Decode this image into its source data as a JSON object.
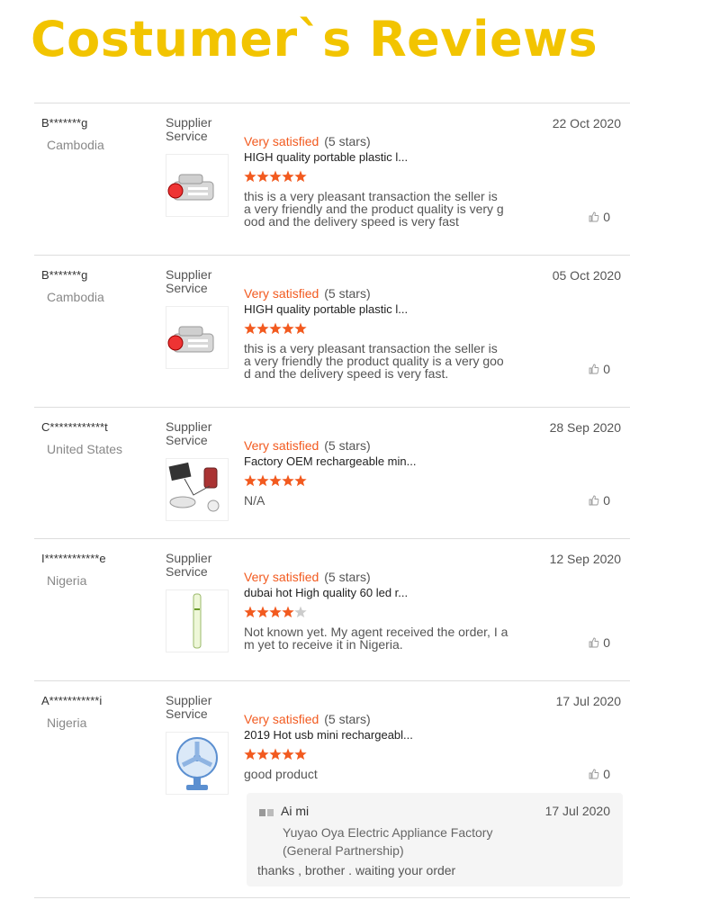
{
  "page": {
    "title": "Costumer`s Reviews"
  },
  "supplier_label": [
    "Supplier",
    "Service"
  ],
  "reviews": [
    {
      "reviewer": "B*******g",
      "country": "Cambodia",
      "date": "22 Oct 2020",
      "rating_text": "Very satisfied",
      "rating_count": "(5 stars)",
      "stars": 5,
      "product_title": "HIGH quality portable plastic l...",
      "text_lines": [
        "this is a very pleasant transaction the seller is",
        "a very friendly and the product quality is very g",
        "ood and the delivery speed is very fast"
      ],
      "likes": "0",
      "thumb_icon": "flashlight-icon"
    },
    {
      "reviewer": "B*******g",
      "country": "Cambodia",
      "date": "05 Oct 2020",
      "rating_text": "Very satisfied",
      "rating_count": "(5 stars)",
      "stars": 5,
      "product_title": "HIGH quality portable plastic l...",
      "text_lines": [
        "this is a very pleasant transaction the seller is",
        "a very friendly the product quality is a very goo",
        "d and the delivery speed is very fast."
      ],
      "likes": "0",
      "thumb_icon": "flashlight-icon"
    },
    {
      "reviewer": "C************t",
      "country": "United States",
      "date": "28 Sep 2020",
      "rating_text": "Very satisfied",
      "rating_count": "(5 stars)",
      "stars": 5,
      "product_title": "Factory OEM rechargeable min...",
      "text_lines": [
        "N/A"
      ],
      "likes": "0",
      "thumb_icon": "solar-kit-icon"
    },
    {
      "reviewer": "I************e",
      "country": "Nigeria",
      "date": "12 Sep 2020",
      "rating_text": "Very satisfied",
      "rating_count": "(5 stars)",
      "stars": 4,
      "product_title": "dubai hot High quality 60 led r...",
      "text_lines": [
        "Not known yet. My agent received the order, I a",
        "m yet to receive it in Nigeria."
      ],
      "likes": "0",
      "thumb_icon": "led-tube-icon"
    },
    {
      "reviewer": "A***********i",
      "country": "Nigeria",
      "date": "17 Jul 2020",
      "rating_text": "Very satisfied",
      "rating_count": "(5 stars)",
      "stars": 5,
      "product_title": "2019 Hot usb mini rechargeabl...",
      "text_lines": [
        "good product"
      ],
      "likes": "0",
      "thumb_icon": "desk-fan-icon",
      "reply": {
        "name": "Ai mi",
        "company_lines": [
          "Yuyao Oya Electric Appliance Factory",
          "(General Partnership)"
        ],
        "date": "17 Jul 2020",
        "text": "thanks , brother . waiting your order"
      }
    }
  ],
  "colors": {
    "title": "#f2c400",
    "rating": "#f25a1f",
    "star_filled": "#f25a1f",
    "star_empty": "#cccccc"
  }
}
